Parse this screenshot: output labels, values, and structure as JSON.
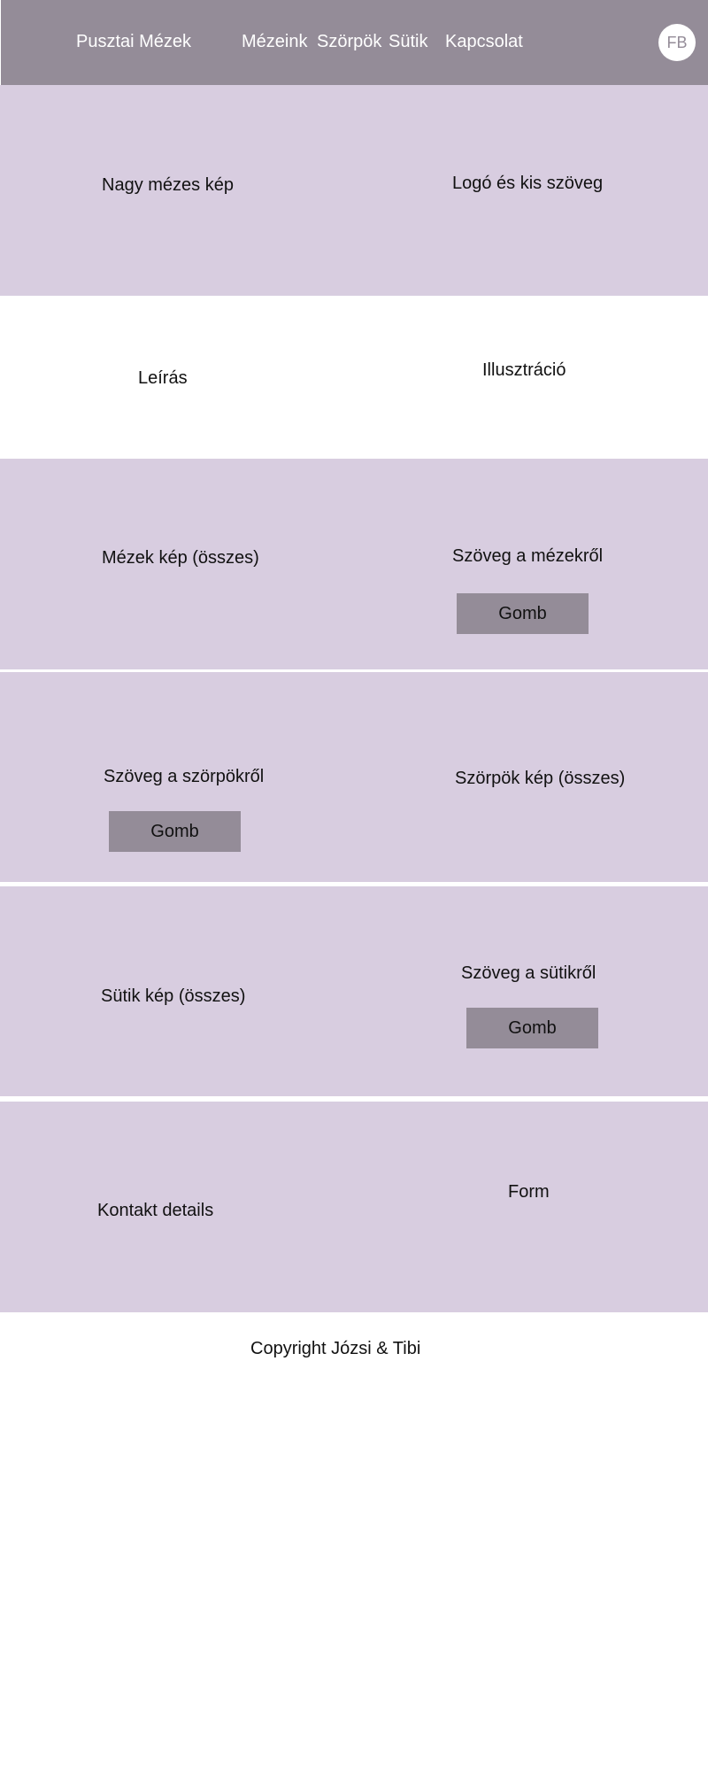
{
  "header": {
    "brand": "Pusztai Mézek",
    "nav": [
      "Mézeink",
      "Szörpök",
      "Sütik",
      "Kapcsolat"
    ],
    "social": "FB"
  },
  "hero": {
    "left": "Nagy mézes kép",
    "right": "Logó és kis szöveg"
  },
  "about": {
    "left": "Leírás",
    "right": "Illusztráció"
  },
  "honeys": {
    "image": "Mézek kép (összes)",
    "text": "Szöveg a mézekről",
    "button": "Gomb"
  },
  "syrups": {
    "text": "Szöveg a szörpökről",
    "button": "Gomb",
    "image": "Szörpök kép (összes)"
  },
  "cookies": {
    "image": "Sütik kép (összes)",
    "text": "Szöveg a sütikről",
    "button": "Gomb"
  },
  "contact": {
    "left": "Kontakt details",
    "right": "Form"
  },
  "footer": {
    "copyright": "Copyright Józsi & Tibi"
  },
  "colors": {
    "header_bg": "#948c98",
    "band_bg": "#d8cde0",
    "button_bg": "#948c98"
  }
}
